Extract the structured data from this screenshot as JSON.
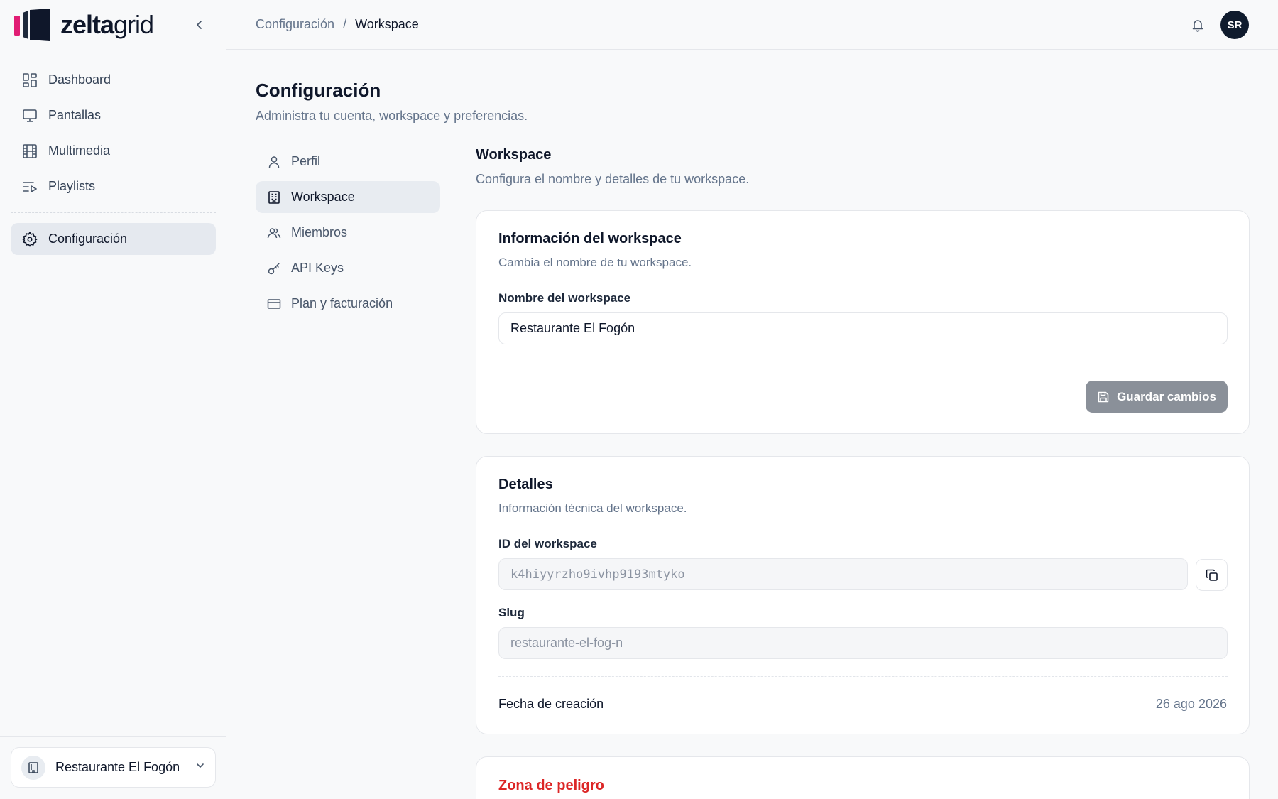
{
  "brand": {
    "name_bold": "zelta",
    "name_light": "grid",
    "colors": {
      "pink": "#e11d74",
      "dark": "#0f172a"
    }
  },
  "sidebar": {
    "items": [
      {
        "label": "Dashboard",
        "icon": "layout-grid-icon"
      },
      {
        "label": "Pantallas",
        "icon": "monitor-icon"
      },
      {
        "label": "Multimedia",
        "icon": "film-icon"
      },
      {
        "label": "Playlists",
        "icon": "list-video-icon"
      },
      {
        "label": "Configuración",
        "icon": "gear-icon",
        "active": true
      }
    ],
    "workspace_switcher": {
      "name": "Restaurante El Fogón"
    }
  },
  "topbar": {
    "breadcrumb": {
      "parent": "Configuración",
      "separator": "/",
      "current": "Workspace"
    },
    "avatar_initials": "SR"
  },
  "page": {
    "title": "Configuración",
    "subtitle": "Administra tu cuenta, workspace y preferencias."
  },
  "settings_nav": [
    {
      "label": "Perfil",
      "icon": "user-icon"
    },
    {
      "label": "Workspace",
      "icon": "building-icon",
      "active": true
    },
    {
      "label": "Miembros",
      "icon": "users-icon"
    },
    {
      "label": "API Keys",
      "icon": "key-icon"
    },
    {
      "label": "Plan y facturación",
      "icon": "credit-card-icon"
    }
  ],
  "section": {
    "title": "Workspace",
    "subtitle": "Configura el nombre y detalles de tu workspace."
  },
  "info_card": {
    "title": "Información del workspace",
    "subtitle": "Cambia el nombre de tu workspace.",
    "name_label": "Nombre del workspace",
    "name_value": "Restaurante El Fogón",
    "save_label": "Guardar cambios"
  },
  "details_card": {
    "title": "Detalles",
    "subtitle": "Información técnica del workspace.",
    "id_label": "ID del workspace",
    "id_value": "k4hiyyrzho9ivhp9193mtyko",
    "slug_label": "Slug",
    "slug_value": "restaurante-el-fog-n",
    "created_label": "Fecha de creación",
    "created_value": "26 ago 2026"
  },
  "danger_card": {
    "title": "Zona de peligro"
  }
}
